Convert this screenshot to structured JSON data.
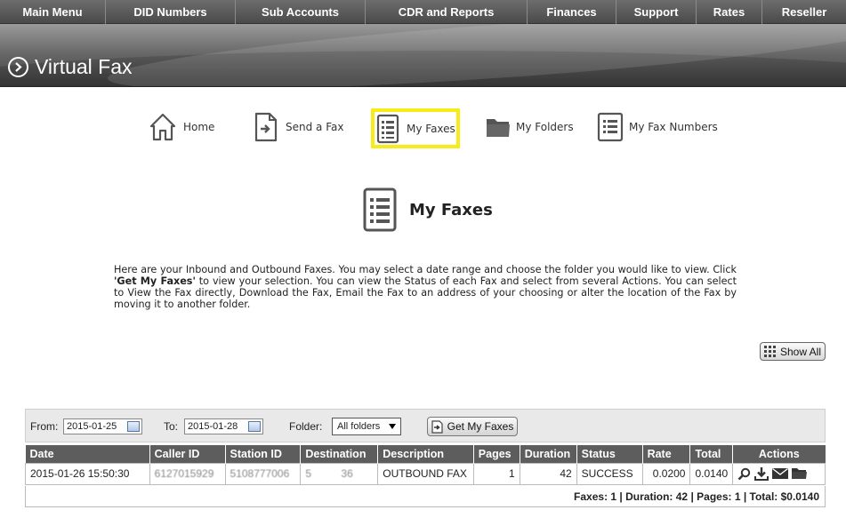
{
  "topnav": {
    "items": [
      {
        "label": "Main Menu"
      },
      {
        "label": "DID Numbers"
      },
      {
        "label": "Sub Accounts"
      },
      {
        "label": "CDR and Reports"
      },
      {
        "label": "Finances"
      },
      {
        "label": "Support"
      },
      {
        "label": "Rates"
      },
      {
        "label": "Reseller"
      }
    ]
  },
  "banner": {
    "title": "Virtual Fax"
  },
  "subnav": {
    "home": "Home",
    "send_fax": "Send a Fax",
    "my_faxes": "My Faxes",
    "my_folders": "My Folders",
    "my_fax_numbers": "My Fax Numbers",
    "active": "My Faxes",
    "active_highlight_color": "#f7ec1a"
  },
  "page": {
    "title": "My Faxes",
    "intro_before": "Here are your Inbound and Outbound Faxes. You may select a date range and choose the folder you would like to view. Click ",
    "intro_bold": "'Get My Faxes'",
    "intro_after": " to view your selection. You can view the Status of each Fax and select from several Actions. You can select to View the Fax directly, Download the Fax, Email the Fax to an address of your choosing or alter the location of the Fax by moving it to another folder.",
    "show_all": "Show All"
  },
  "filter": {
    "from_label": "From:",
    "from_value": "2015-01-25",
    "to_label": "To:",
    "to_value": "2015-01-28",
    "folder_label": "Folder:",
    "folder_value": "All folders",
    "get_button": "Get My Faxes"
  },
  "table": {
    "headers": [
      "Date",
      "Caller ID",
      "Station ID",
      "Destination",
      "Description",
      "Pages",
      "Duration",
      "Status",
      "Rate",
      "Total",
      "Actions"
    ],
    "rows": [
      {
        "date": "2015-01-26 15:50:30",
        "caller_id": "6127015929",
        "station_id": "5108777006",
        "destination": "5          36",
        "description": "OUTBOUND FAX",
        "pages": "1",
        "duration": "42",
        "status": "SUCCESS",
        "rate": "0.0200",
        "total": "0.0140",
        "actions": [
          "view-icon",
          "download-icon",
          "email-icon",
          "folder-icon"
        ]
      }
    ],
    "summary": "Faxes: 1 | Duration: 42 | Pages: 1 | Total: $0.0140"
  },
  "colors": {
    "header_bg": "#5d5d5d",
    "nav_bg": "#4a4a4a",
    "filter_bg": "#e9e9e9"
  }
}
